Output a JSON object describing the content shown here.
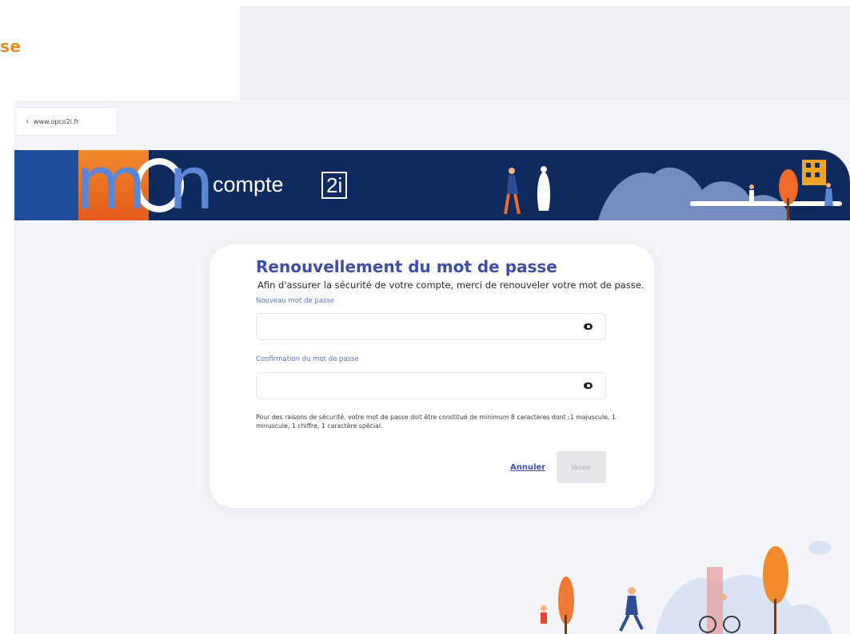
{
  "slide": {
    "title_fragment": "se"
  },
  "browser": {
    "back_label": "www.opco2i.fr"
  },
  "banner": {
    "logo_text": "mon",
    "compte_label": "compte",
    "brand_badge": "2i"
  },
  "form": {
    "title": "Renouvellement du mot de passe",
    "subtitle": "Afin d'assurer la sécurité de votre compte, merci de renouveler votre mot de passe.",
    "new_password_label": "Nouveau mot de passe",
    "new_password_value": "",
    "confirm_password_label": "Confirmation du mot de passe",
    "confirm_password_value": "",
    "hint": "Pour des raisons de sécurité, votre mot de passe doit être constitué de minimum 8 caractères dont :1 majuscule, 1 minuscule, 1 chiffre, 1 caractère spécial.",
    "cancel_label": "Annuler",
    "submit_label": "Valider",
    "submit_enabled": false
  },
  "colors": {
    "accent_orange": "#e98a1f",
    "banner_navy": "#0e2a5e",
    "title_blue": "#3f4fa6",
    "label_blue": "#5a73c8"
  }
}
